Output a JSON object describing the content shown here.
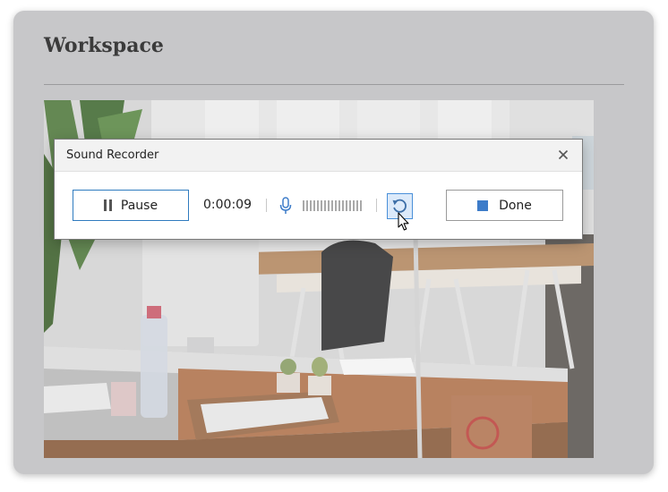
{
  "card": {
    "title": "Workspace"
  },
  "photo": {
    "subject": "office-desks-photo"
  },
  "recorder": {
    "title": "Sound Recorder",
    "pause_label": "Pause",
    "timer": "0:00:09",
    "done_label": "Done",
    "icons": {
      "close": "close-icon",
      "pause": "pause-icon",
      "mic": "microphone-icon",
      "retry": "retry-icon",
      "stop": "stop-icon",
      "cursor": "mouse-cursor-icon"
    }
  },
  "colors": {
    "card_bg": "#c7c7c9",
    "accent": "#2f7bbf",
    "stop": "#3d7cc9"
  }
}
